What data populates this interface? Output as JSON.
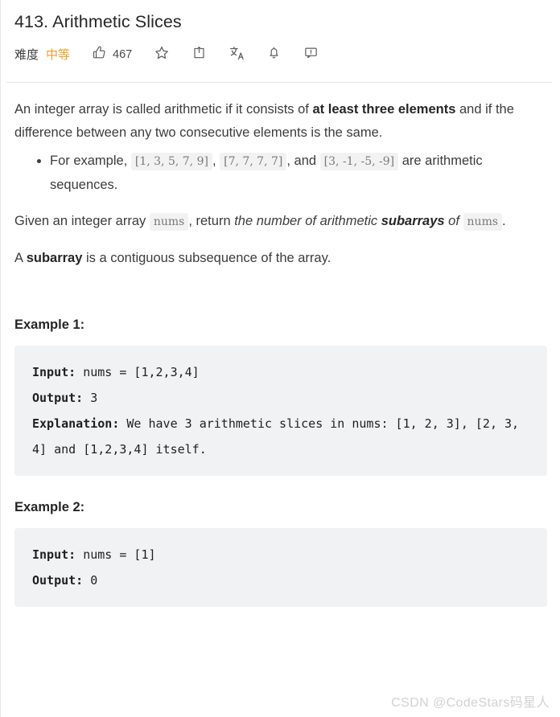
{
  "header": {
    "title": "413. Arithmetic Slices",
    "difficulty_label": "难度",
    "difficulty_value": "中等",
    "difficulty_color": "#f39c2a",
    "like_count": "467",
    "icons": [
      "thumbs-up-icon",
      "star-icon",
      "share-icon",
      "translate-icon",
      "bell-icon",
      "feedback-icon"
    ]
  },
  "description": {
    "p1_part1": "An integer array is called arithmetic if it consists of ",
    "p1_bold": "at least three elements",
    "p1_part2": " and if the difference between any two consecutive elements is the same.",
    "bullet": {
      "lead": "For example, ",
      "code1": "[1, 3, 5, 7, 9]",
      "sep1": ", ",
      "code2": "[7, 7, 7, 7]",
      "sep2": ", and ",
      "code3": "[3, -1, -5, -9]",
      "tail": " are arithmetic sequences."
    },
    "p2_part1": "Given an integer array ",
    "p2_code1": "nums",
    "p2_part2": ", return ",
    "p2_italic1": "the number of arithmetic ",
    "p2_bolditalic": "subarrays",
    "p2_italic2": " of ",
    "p2_code2": "nums",
    "p2_part3": ".",
    "p3_part1": "A ",
    "p3_bold": "subarray",
    "p3_part2": " is a contiguous subsequence of the array."
  },
  "examples": [
    {
      "heading": "Example 1:",
      "lines": [
        {
          "key": "Input:",
          "value": " nums = [1,2,3,4]"
        },
        {
          "key": "Output:",
          "value": " 3"
        },
        {
          "key": "Explanation:",
          "value": " We have 3 arithmetic slices in nums: [1, 2, 3], [2, 3, 4] and [1,2,3,4] itself."
        }
      ]
    },
    {
      "heading": "Example 2:",
      "lines": [
        {
          "key": "Input:",
          "value": " nums = [1]"
        },
        {
          "key": "Output:",
          "value": " 0"
        }
      ]
    }
  ],
  "watermark": "CSDN @CodeStars码星人"
}
